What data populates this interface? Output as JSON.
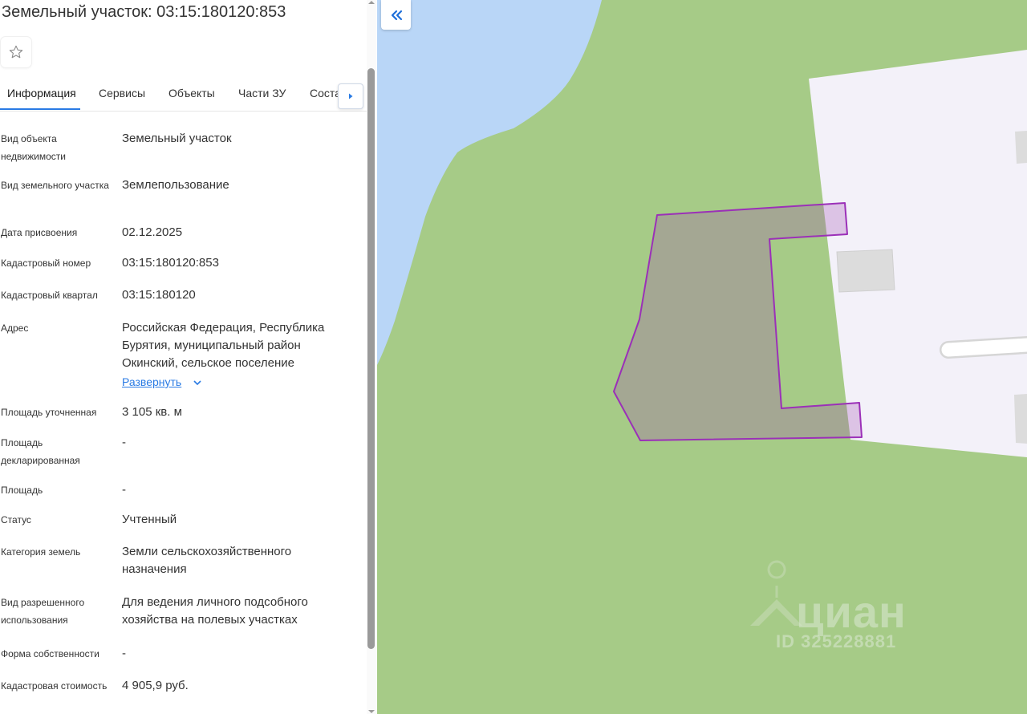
{
  "header": {
    "title": "Земельный участок: 03:15:180120:853"
  },
  "icons": {
    "favorite": "star-outline-icon",
    "tabs_next": "triangle-right-icon",
    "collapse": "double-chevron-left-icon",
    "expand": "chevron-down-icon"
  },
  "tabs": [
    {
      "label": "Информация",
      "active": true
    },
    {
      "label": "Сервисы"
    },
    {
      "label": "Объекты"
    },
    {
      "label": "Части ЗУ"
    },
    {
      "label": "Соста"
    }
  ],
  "fields": {
    "object_type": {
      "label": "Вид объекта недвижимости",
      "value": "Земельный участок"
    },
    "land_type": {
      "label": "Вид земельного участка",
      "value": "Землепользование"
    },
    "assigned_date": {
      "label": "Дата присвоения",
      "value": "02.12.2025"
    },
    "cadastral_number": {
      "label": "Кадастровый номер",
      "value": "03:15:180120:853"
    },
    "cadastral_block": {
      "label": "Кадастровый квартал",
      "value": "03:15:180120"
    },
    "address": {
      "label": "Адрес",
      "value": "Российская Федерация, Республика Бурятия, муниципальный район Окинский, сельское поселение",
      "expand_label": "Развернуть"
    },
    "area_refined": {
      "label": "Площадь уточненная",
      "value": "3 105 кв. м"
    },
    "area_declared": {
      "label": "Площадь декларированная",
      "value": "-"
    },
    "area": {
      "label": "Площадь",
      "value": "-"
    },
    "status": {
      "label": "Статус",
      "value": "Учтенный"
    },
    "land_category": {
      "label": "Категория земель",
      "value": "Земли сельскохозяйственного назначения"
    },
    "permitted_use": {
      "label": "Вид разрешенного использования",
      "value": "Для ведения личного подсобного хозяйства на полевых участках"
    },
    "ownership_form": {
      "label": "Форма собственности",
      "value": "-"
    },
    "cadastral_value": {
      "label": "Кадастровая стоимость",
      "value": "4 905,9 руб."
    }
  },
  "map": {
    "watermark_brand": "циан",
    "watermark_id": "ID 325228881",
    "colors": {
      "water": "#b9d6f7",
      "grass": "#a6cb87",
      "built_area": "#f3f1f9",
      "building": "#dcdcdc",
      "parcel_outline": "#9b30b8",
      "parcel_fill": "rgba(160,75,180,0.28)"
    }
  }
}
